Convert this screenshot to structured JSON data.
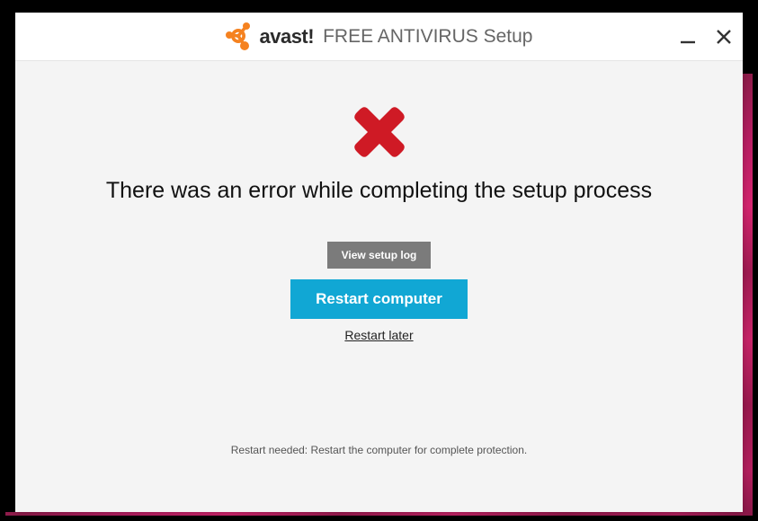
{
  "titlebar": {
    "brand": "avast!",
    "suffix": "FREE ANTIVIRUS Setup"
  },
  "content": {
    "heading": "There was an error while completing the setup process",
    "view_log_label": "View setup log",
    "restart_label": "Restart computer",
    "later_label": "Restart later"
  },
  "footer": {
    "note": "Restart needed: Restart the computer for complete protection."
  }
}
